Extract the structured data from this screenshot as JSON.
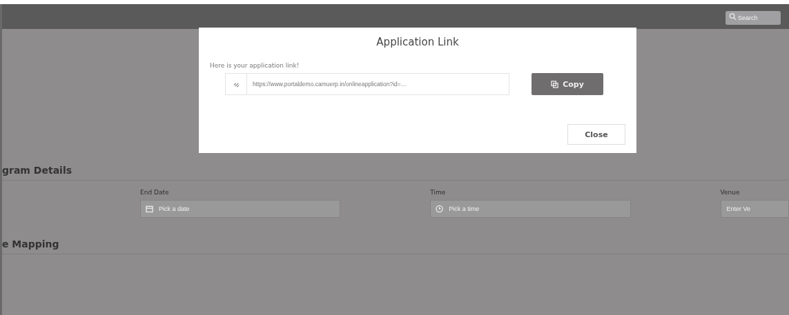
{
  "top_bar": {
    "search": {
      "placeholder": "Search"
    }
  },
  "dialog": {
    "title": "Application Link",
    "message": "Here is your application link!",
    "link": {
      "value": "https://www.portaldemo.camuerp.in/onlineapplication?id=…"
    },
    "copy_button": "Copy",
    "close_button": "Close"
  },
  "sections": [
    {
      "title": "gram Details",
      "fields": [
        {
          "label": "End Date",
          "placeholder": "Pick a date",
          "kind": "date"
        },
        {
          "label": "Time",
          "placeholder": "Pick a time",
          "kind": "time"
        },
        {
          "label": "Venue",
          "placeholder": "Enter Ve",
          "kind": "text"
        }
      ]
    },
    {
      "title": "e Mapping"
    }
  ]
}
